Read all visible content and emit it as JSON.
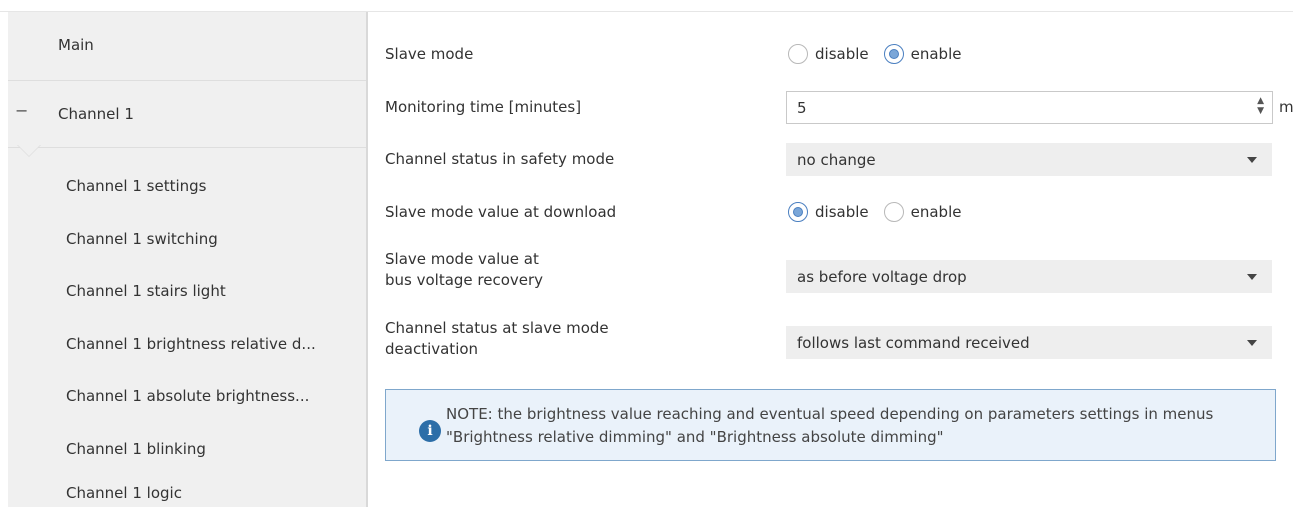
{
  "sidebar": {
    "main_label": "Main",
    "group_toggle": "−",
    "group_label": "Channel 1",
    "items": [
      {
        "label": "Channel 1 settings"
      },
      {
        "label": "Channel 1 switching"
      },
      {
        "label": "Channel 1 stairs light"
      },
      {
        "label": "Channel 1 brightness relative d..."
      },
      {
        "label": "Channel 1 absolute brightness..."
      },
      {
        "label": "Channel 1 blinking"
      },
      {
        "label": "Channel 1 logic"
      }
    ]
  },
  "params": {
    "slave_mode": {
      "label": "Slave mode",
      "options": [
        "disable",
        "enable"
      ],
      "selected": "enable"
    },
    "monitoring_time": {
      "label": "Monitoring time [minutes]",
      "value": "5",
      "unit": "minutes"
    },
    "status_safety": {
      "label": "Channel status in safety mode",
      "value": "no change"
    },
    "value_download": {
      "label": "Slave mode value at download",
      "options": [
        "disable",
        "enable"
      ],
      "selected": "disable"
    },
    "value_recovery": {
      "label_line1": "Slave mode value at",
      "label_line2": "bus voltage recovery",
      "value": "as before voltage drop"
    },
    "status_deactivation": {
      "label_line1": "Channel status at slave mode",
      "label_line2": "deactivation",
      "value": "follows last command received"
    }
  },
  "note": {
    "icon": "info-icon",
    "text": "NOTE: the brightness value reaching and eventual speed depending on parameters settings in menus \"Brightness relative dimming\" and \"Brightness absolute dimming\""
  },
  "colors": {
    "accent": "#2c6ea8",
    "note_bg": "#eaf2fa",
    "note_border": "#7fa7cc"
  }
}
